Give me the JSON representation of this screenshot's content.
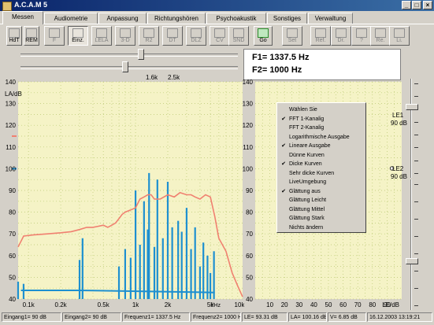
{
  "window": {
    "title": "A.C.A.M 5"
  },
  "tabs": [
    {
      "label": "Messen",
      "active": true
    },
    {
      "label": "Audiometrie"
    },
    {
      "label": "Anpassung"
    },
    {
      "label": "Richtungshören"
    },
    {
      "label": "Psychoakustik"
    },
    {
      "label": "Sonstiges"
    },
    {
      "label": "Verwaltung"
    }
  ],
  "toolbar": [
    {
      "label": "HdT",
      "icon": "headset-icon",
      "state": "normal"
    },
    {
      "label": "REM",
      "icon": "ear-probe-icon",
      "state": "normal"
    },
    {
      "label": "F",
      "icon": "filter-icon",
      "state": "disabled"
    },
    {
      "label": "Einz.",
      "icon": "single-icon",
      "state": "pressed"
    },
    {
      "label": "LELA",
      "icon": "lela-icon",
      "state": "disabled"
    },
    {
      "label": "3-D",
      "icon": "3d-icon",
      "state": "disabled"
    },
    {
      "label": "R2",
      "icon": "r2-icon",
      "state": "disabled"
    },
    {
      "label": "DT",
      "icon": "dt-icon",
      "state": "disabled"
    },
    {
      "label": "DLZ",
      "icon": "dlz-icon",
      "state": "disabled"
    },
    {
      "label": "CV",
      "icon": "cv-icon",
      "state": "disabled"
    },
    {
      "label": "SND",
      "icon": "snd-icon",
      "state": "disabled"
    },
    {
      "label": "Go",
      "icon": "run-icon",
      "state": "normal"
    },
    {
      "label": "Set",
      "icon": "settings-icon",
      "state": "disabled"
    },
    {
      "label": "Ref.",
      "icon": "ref-icon",
      "state": "disabled"
    },
    {
      "label": "Dr.",
      "icon": "print-icon",
      "state": "disabled"
    },
    {
      "label": "?",
      "icon": "help-icon",
      "state": "disabled"
    },
    {
      "label": "Re.",
      "icon": "right-ear-icon",
      "state": "disabled"
    },
    {
      "label": "Li.",
      "icon": "left-ear-icon",
      "state": "disabled"
    }
  ],
  "frequency": {
    "f1_text": "F1= 1337.5 Hz",
    "f2_text": "F2= 1000 Hz",
    "marker_left": "1.6k",
    "marker_right": "2.5k",
    "f1_slider": 0.55,
    "f2_slider": 0.48
  },
  "level_panels": [
    {
      "label": "LE1",
      "value": "90 dB",
      "slider": 0.25
    },
    {
      "label": "LE2",
      "value": "90 dB",
      "slider": 0.6
    }
  ],
  "context_menu": {
    "items": [
      {
        "label": "Wählen Sie",
        "checked": false
      },
      {
        "label": "FFT 1-Kanalig",
        "checked": true
      },
      {
        "label": "FFT 2-Kanalig",
        "checked": false
      },
      {
        "label": "Logarithmische Ausgabe",
        "checked": false
      },
      {
        "label": "Lineare Ausgabe",
        "checked": true
      },
      {
        "label": "Dünne Kurven",
        "checked": false
      },
      {
        "label": "Dicke Kurven",
        "checked": true
      },
      {
        "label": "Sehr dicke Kurven",
        "checked": false
      },
      {
        "label": "LiveUmgebung",
        "checked": false
      },
      {
        "label": "Glättung aus",
        "checked": true
      },
      {
        "label": "Glättung Leicht",
        "checked": false
      },
      {
        "label": "Glättung Mittel",
        "checked": false
      },
      {
        "label": "Glättung Stark",
        "checked": false
      },
      {
        "label": "Nichts ändern",
        "checked": false
      }
    ]
  },
  "status_bar": [
    "Eingang1= 90 dB",
    "Eingang2= 90 dB",
    "Frequenz1= 1337.5 Hz",
    "Frequenz2= 1000 Hz",
    "LE= 93.31 dB",
    "LA= 100.16 dB",
    "V= 6.85 dB",
    "16.12.2003 13:19:21"
  ],
  "colors": {
    "plot_bg": "#f5f3c6",
    "spectrum": "#1e90d0",
    "response": "#f08070",
    "grid": "#b8c870"
  },
  "chart_data": [
    {
      "type": "line",
      "ylabel": "LA/dB",
      "xlabel": "f/Hz",
      "ylim": [
        40,
        140
      ],
      "xscale": "log",
      "xlim": [
        80,
        10000
      ],
      "yticks": [
        40,
        50,
        60,
        70,
        80,
        90,
        100,
        110,
        120,
        130,
        140
      ],
      "xticks": [
        {
          "label": "0.1k",
          "value": 100
        },
        {
          "label": "0.2k",
          "value": 200
        },
        {
          "label": "0.5k",
          "value": 500
        },
        {
          "label": "1k",
          "value": 1000
        },
        {
          "label": "2k",
          "value": 2000
        },
        {
          "label": "5k",
          "value": 5000
        },
        {
          "label": "10k",
          "value": 10000
        }
      ],
      "grid": true,
      "markers": [
        {
          "y": 115,
          "color": "#f08070"
        },
        {
          "y": 100,
          "color": "#1e90d0"
        }
      ],
      "series": [
        {
          "style": "line",
          "color": "#f08070",
          "x": [
            80,
            90,
            110,
            150,
            200,
            250,
            300,
            350,
            400,
            450,
            500,
            550,
            600,
            650,
            700,
            750,
            800,
            900,
            1000,
            1100,
            1200,
            1300,
            1400,
            1500,
            1700,
            2000,
            2300,
            2600,
            3000,
            3300,
            3600,
            4000,
            4500,
            5000,
            5500,
            6000,
            7000,
            8000,
            9000,
            10000
          ],
          "y": [
            64,
            69,
            69.5,
            70,
            70.5,
            71,
            72,
            73,
            73,
            73.5,
            74,
            73,
            74,
            75,
            77,
            79,
            80,
            81,
            82,
            86,
            87,
            88,
            88,
            86,
            86,
            88,
            87,
            89,
            88,
            88,
            87,
            86,
            88,
            87,
            78,
            68,
            62,
            52,
            46,
            41
          ]
        },
        {
          "style": "stem",
          "color": "#1e90d0",
          "x": [
            80,
            90,
            300,
            320,
            700,
            800,
            900,
            1000,
            1100,
            1200,
            1300,
            1337.5,
            1500,
            1600,
            1800,
            2000,
            2200,
            2500,
            2700,
            3000,
            3300,
            3600,
            4000,
            4300,
            4700,
            5000,
            5400
          ],
          "y": [
            48,
            47,
            58,
            68,
            55,
            63,
            59,
            90,
            65,
            85,
            72,
            98,
            64,
            95,
            68,
            94,
            73,
            76,
            71,
            82,
            63,
            73,
            55,
            66,
            60,
            52,
            62
          ]
        }
      ]
    },
    {
      "type": "line",
      "ylabel": "LE/dB",
      "ylim": [
        40,
        140
      ],
      "xlim": [
        0,
        100
      ],
      "yticks": [
        40,
        50,
        60,
        70,
        80,
        90,
        100,
        110,
        120,
        130,
        140
      ],
      "xticks": [
        {
          "label": "10",
          "value": 10
        },
        {
          "label": "20",
          "value": 20
        },
        {
          "label": "30",
          "value": 30
        },
        {
          "label": "40",
          "value": 40
        },
        {
          "label": "50",
          "value": 50
        },
        {
          "label": "60",
          "value": 60
        },
        {
          "label": "70",
          "value": 70
        },
        {
          "label": "80",
          "value": 80
        },
        {
          "label": "90",
          "value": 90
        }
      ],
      "grid": true,
      "points": [
        {
          "x": 93.31,
          "y": 100.16
        }
      ]
    }
  ]
}
